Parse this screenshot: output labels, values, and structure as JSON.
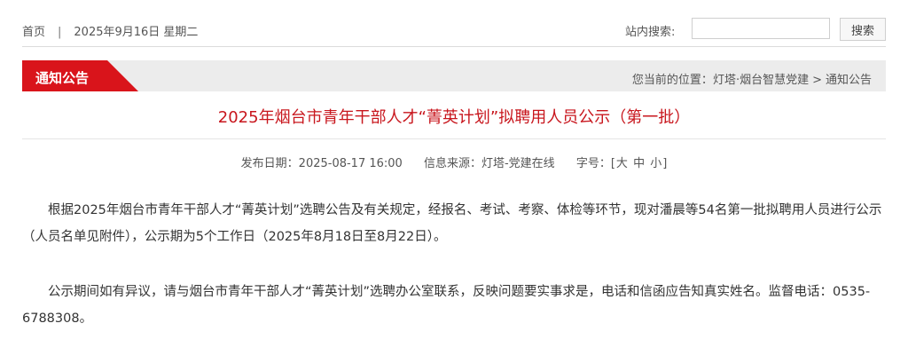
{
  "topbar": {
    "home": "首页",
    "separator": "|",
    "date": "2025年9月16日 星期二",
    "search_label": "站内搜索:",
    "search_placeholder": "",
    "search_button": "搜索"
  },
  "section": {
    "title": "通知公告",
    "breadcrumb_prefix": "您当前的位置：",
    "breadcrumb_site": "灯塔·烟台智慧党建",
    "breadcrumb_sep": ">",
    "breadcrumb_current": "通知公告",
    "accent_color": "#c8161d"
  },
  "article": {
    "title": "2025年烟台市青年干部人才“菁英计划”拟聘用人员公示（第一批）",
    "publish_date": "发布日期：2025-08-17 16:00",
    "source": "信息来源：灯塔-党建在线",
    "font_size_label": "字号：",
    "font_size_open": "[",
    "size_large": "大",
    "size_medium": "中",
    "size_small": "小",
    "font_size_close": "]",
    "paragraphs": [
      "根据2025年烟台市青年干部人才“菁英计划”选聘公告及有关规定，经报名、考试、考察、体检等环节，现对潘晨等54名第一批拟聘用人员进行公示（人员名单见附件），公示期为5个工作日（2025年8月18日至8月22日）。",
      "公示期间如有异议，请与烟台市青年干部人才“菁英计划”选聘办公室联系，反映问题要实事求是，电话和信函应告知真实姓名。监督电话：0535-6788308。"
    ]
  }
}
